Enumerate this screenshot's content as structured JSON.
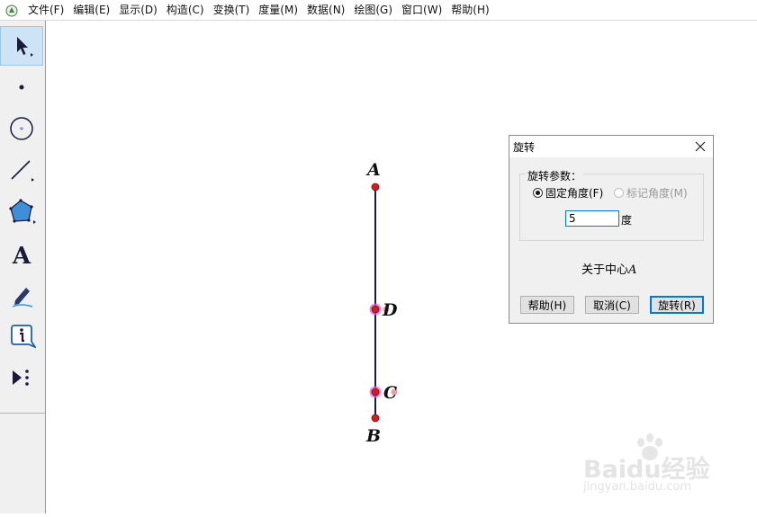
{
  "menubar": {
    "items": [
      "文件(F)",
      "编辑(E)",
      "显示(D)",
      "构造(C)",
      "变换(T)",
      "度量(M)",
      "数据(N)",
      "绘图(G)",
      "窗口(W)",
      "帮助(H)"
    ]
  },
  "toolbar": {
    "tools": [
      "arrow-select-icon",
      "point-icon",
      "compass-icon",
      "line-segment-icon",
      "polygon-icon",
      "text-tool-icon",
      "marker-icon",
      "info-icon",
      "custom-tools-icon"
    ]
  },
  "canvas": {
    "points": {
      "A": "A",
      "B": "B",
      "C": "C",
      "D": "D"
    },
    "segment_color": "#1a1a4a",
    "point_color": "#cc2020",
    "selected_color": "#d050d0"
  },
  "dialog": {
    "title": "旋转",
    "group_label": "旋转参数：",
    "radio_fixed": "固定角度(F)",
    "radio_marked": "标记角度(M)",
    "angle_value": "5",
    "unit": "度",
    "center_prefix": "关于中心",
    "center_point": "A",
    "buttons": {
      "help": "帮助(H)",
      "cancel": "取消(C)",
      "rotate": "旋转(R)"
    }
  },
  "watermark": {
    "brand": "Baidu经验",
    "url": "jingyan.baidu.com"
  }
}
